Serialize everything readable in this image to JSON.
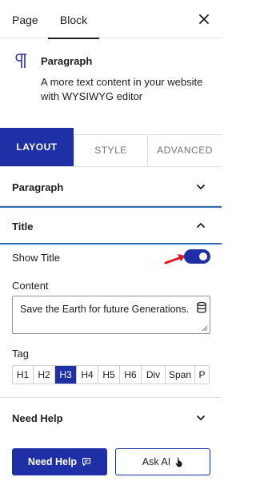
{
  "tabs": {
    "page": "Page",
    "block": "Block"
  },
  "block": {
    "title": "Paragraph",
    "description": "A more text content in your website with WYSIWYG editor"
  },
  "section_tabs": {
    "layout": "LAYOUT",
    "style": "STYLE",
    "advanced": "ADVANCED"
  },
  "panels": {
    "paragraph": "Paragraph",
    "title": "Title",
    "need_help": "Need Help"
  },
  "title_panel": {
    "show_title_label": "Show Title",
    "show_title_enabled": true,
    "content_label": "Content",
    "content_value": "Save the Earth for future Generations.",
    "tag_label": "Tag",
    "tags": [
      "H1",
      "H2",
      "H3",
      "H4",
      "H5",
      "H6",
      "Div",
      "Span",
      "P"
    ],
    "selected_tag": "H3"
  },
  "buttons": {
    "need_help": "Need Help",
    "ask_ai": "Ask AI"
  },
  "colors": {
    "accent": "#1f2fa5",
    "arrow": "#e0171f",
    "focus_border": "#2f6bb0"
  }
}
